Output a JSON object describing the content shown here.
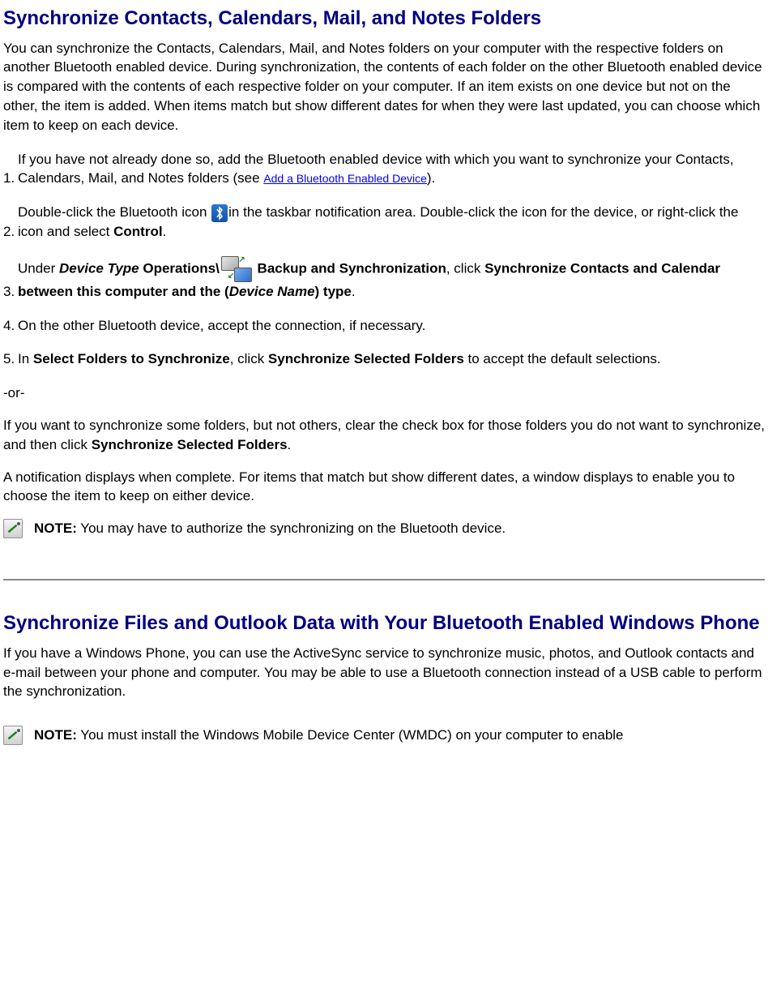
{
  "section1": {
    "title": "Synchronize Contacts, Calendars, Mail, and Notes Folders",
    "intro": "You can synchronize the Contacts, Calendars, Mail, and Notes folders on your computer with the respective folders on another Bluetooth enabled device. During synchronization, the contents of each folder on the other Bluetooth enabled device is compared with the contents of each respective folder on your computer. If an item exists on one device but not on the other, the item is added. When items match but show different dates for when they were last updated, you can choose which item to keep on each device.",
    "step1_num": "1.",
    "step1_pre": "If you have not already done so, add the Bluetooth enabled device with which you want to synchronize your Contacts, Calendars, Mail, and Notes folders (see ",
    "step1_link": "Add a Bluetooth Enabled Device",
    "step1_post": ").",
    "step2_num": "2.",
    "step2_pre": "Double-click the Bluetooth icon ",
    "step2_mid": "in the taskbar notification area. Double-click the icon for the device, or right-click the icon and select ",
    "step2_bold": "Control",
    "step2_post": ".",
    "step3_num": "3.",
    "step3_a": "Under ",
    "step3_b": "Device Type",
    "step3_c": " Operations\\",
    "step3_d": " Backup and Synchronization",
    "step3_e": ", click ",
    "step3_f": "Synchronize Contacts and Calendar between this computer and the (",
    "step3_g": "Device Name",
    "step3_h": ") type",
    "step3_i": ".",
    "step4_num": "4.",
    "step4_text": "On the other Bluetooth device, accept the connection, if necessary.",
    "step5_num": "5.",
    "step5_a": "In ",
    "step5_b": "Select Folders to Synchronize",
    "step5_c": ", click ",
    "step5_d": "Synchronize Selected Folders",
    "step5_e": " to accept the default selections.",
    "or_text": "-or-",
    "alt_a": "If you want to synchronize some folders, but not others, clear the check box for those folders you do not want to synchronize, and then click ",
    "alt_b": "Synchronize Selected Folders",
    "alt_c": ".",
    "result": "A notification displays when complete. For items that match but show different dates, a window displays to enable you to choose the item to keep on either device.",
    "note1_label": "NOTE:",
    "note1_text": " You may have to authorize the synchronizing on the Bluetooth device."
  },
  "section2": {
    "title": "Synchronize Files and Outlook Data with Your Bluetooth Enabled Windows Phone",
    "intro": "If you have a Windows Phone, you can use the ActiveSync service to synchronize music, photos, and Outlook contacts and e-mail between your phone and computer. You may be able to use a Bluetooth connection instead of a USB cable to perform the synchronization.",
    "note2_label": "NOTE:",
    "note2_text": " You must install the Windows Mobile Device Center (WMDC) on your computer to enable"
  }
}
